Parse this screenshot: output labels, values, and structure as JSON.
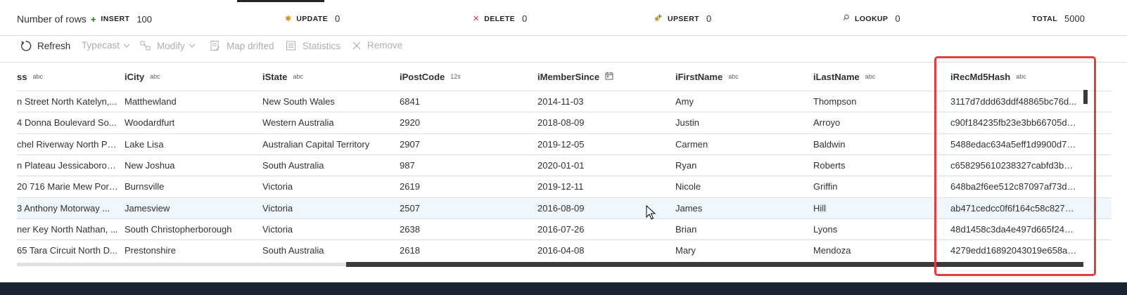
{
  "stats": {
    "title": "Number of rows",
    "items": [
      {
        "icon": "plus-icon",
        "label": "INSERT",
        "value": "100",
        "color": "#107c10"
      },
      {
        "icon": "asterisk-icon",
        "label": "UPDATE",
        "value": "0",
        "color": "#d29200"
      },
      {
        "icon": "x-icon",
        "label": "DELETE",
        "value": "0",
        "color": "#d13438"
      },
      {
        "icon": "upsert-icon",
        "label": "UPSERT",
        "value": "0",
        "color": "#107c10"
      },
      {
        "icon": "search-icon",
        "label": "LOOKUP",
        "value": "0",
        "color": "#605e5c"
      },
      {
        "icon": "",
        "label": "TOTAL",
        "value": "5000",
        "color": ""
      }
    ]
  },
  "toolbar": {
    "refresh": "Refresh",
    "typecast": "Typecast",
    "modify": "Modify",
    "map_drifted": "Map drifted",
    "statistics": "Statistics",
    "remove": "Remove"
  },
  "columns": [
    {
      "name": "ss",
      "type": "abc"
    },
    {
      "name": "iCity",
      "type": "abc"
    },
    {
      "name": "iState",
      "type": "abc"
    },
    {
      "name": "iPostCode",
      "type": "12s"
    },
    {
      "name": "iMemberSince",
      "type": "calendar-icon"
    },
    {
      "name": "iFirstName",
      "type": "abc"
    },
    {
      "name": "iLastName",
      "type": "abc"
    },
    {
      "name": "iRecMd5Hash",
      "type": "abc"
    }
  ],
  "rows": [
    [
      "n Street North Katelyn,...",
      "Matthewland",
      "New South Wales",
      "6841",
      "2014-11-03",
      "Amy",
      "Thompson",
      "3117d7ddd63ddf48865bc76d..."
    ],
    [
      "4 Donna Boulevard So...",
      "Woodardfurt",
      "Western Australia",
      "2920",
      "2018-08-09",
      "Justin",
      "Arroyo",
      "c90f184235fb23e3bb66705dd..."
    ],
    [
      "chel Riverway North Ph...",
      "Lake Lisa",
      "Australian Capital Territory",
      "2907",
      "2019-12-05",
      "Carmen",
      "Baldwin",
      "5488edac634a5eff1d9900d76..."
    ],
    [
      "n Plateau Jessicaborou...",
      "New Joshua",
      "South Australia",
      "987",
      "2020-01-01",
      "Ryan",
      "Roberts",
      "c658295610238327cabfd3bad..."
    ],
    [
      "20 716 Marie Mew Port...",
      "Burnsville",
      "Victoria",
      "2619",
      "2019-12-11",
      "Nicole",
      "Griffin",
      "648ba2f6ee512c87097af73da..."
    ],
    [
      "3 Anthony Motorway ...",
      "Jamesview",
      "Victoria",
      "2507",
      "2016-08-09",
      "James",
      "Hill",
      "ab471cedcc0f6f164c58c827b7..."
    ],
    [
      "ner Key North Nathan, ...",
      "South Christopherborough",
      "Victoria",
      "2638",
      "2016-07-26",
      "Brian",
      "Lyons",
      "48d1458c3da4e497d665f2436..."
    ],
    [
      "65 Tara Circuit North D...",
      "Prestonshire",
      "South Australia",
      "2618",
      "2016-04-08",
      "Mary",
      "Mendoza",
      "4279edd16892043019e658a9f..."
    ]
  ],
  "selected_row": 5,
  "highlight_color": "#e33e3e"
}
